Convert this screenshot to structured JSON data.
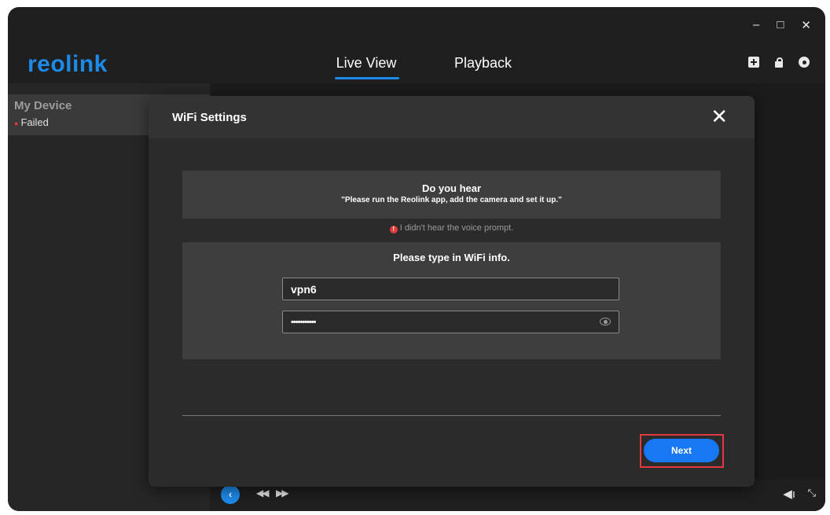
{
  "window": {
    "minimize_glyph": "–",
    "maximize_glyph": "□",
    "close_glyph": "✕"
  },
  "header": {
    "logo": "reolink",
    "tabs": [
      {
        "label": "Live View",
        "active": true
      },
      {
        "label": "Playback",
        "active": false
      }
    ],
    "icons": [
      "add-icon",
      "lock-icon",
      "gear-icon"
    ]
  },
  "sidebar": {
    "devices": [
      {
        "name": "My Device",
        "status": "Failed",
        "status_color": "#e03b3b"
      }
    ]
  },
  "dialog": {
    "title": "WiFi Settings",
    "close_glyph": "✕",
    "prompt_title": "Do you hear",
    "prompt_text": "\"Please run the Reolink app, add the camera and set it up.\"",
    "no_voice_link": "I didn't hear the voice prompt.",
    "wifi_title": "Please type in WiFi info.",
    "ssid_value": "vpn6",
    "password_value": "•••••••••••",
    "next_label": "Next"
  },
  "playback_controls": {
    "back_glyph": "‹",
    "rewind_glyph": "◀◀",
    "forward_glyph": "▶▶",
    "volume_glyph": "◀ı",
    "fullscreen_glyph": "⤡"
  },
  "colors": {
    "accent": "#1d8ae8",
    "button": "#1877f2",
    "highlight": "#e2383f",
    "error": "#e03b3b"
  }
}
